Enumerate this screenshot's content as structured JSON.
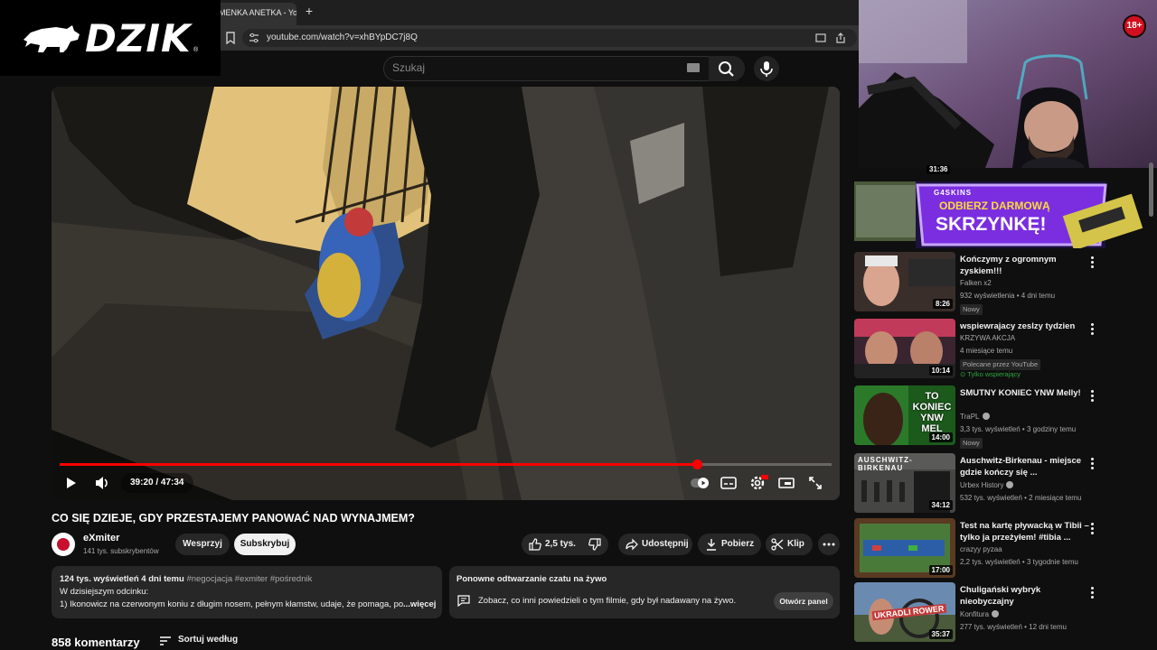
{
  "browser": {
    "tab_title": "MENKA ANETKA - You",
    "new_tab": "+",
    "url": "youtube.com/watch?v=xhBYpDC7j8Q"
  },
  "overlay_logo": {
    "text": "DZIK",
    "reg": "®"
  },
  "search": {
    "placeholder": "Szukaj"
  },
  "player": {
    "time": "39:20 / 47:34",
    "progress_fraction": 0.826
  },
  "video": {
    "title": "CO SIĘ DZIEJE, GDY PRZESTAJEMY PANOWAĆ NAD WYNAJMEM?",
    "channel": "eXmiter",
    "subscribers": "141 tys. subskrybentów",
    "join_label": "Wesprzyj",
    "subscribe_label": "Subskrybuj",
    "likes": "2,5 tys.",
    "share_label": "Udostępnij",
    "download_label": "Pobierz",
    "clip_label": "Klip"
  },
  "description": {
    "stats": "124 tys. wyświetleń  4 dni temu",
    "tags": "#negocjacja #exmiter #pośrednik",
    "line1": "W dzisiejszym odcinku:",
    "line2": "1) Ikonowicz na czerwonym koniu z długim nosem, pełnym kłamstw, udaje, że pomaga, poc",
    "more": "...więcej"
  },
  "chat_replay": {
    "title": "Ponowne odtwarzanie czatu na żywo",
    "text": "Zobacz, co inni powiedzieli o tym filmie, gdy był nadawany na żywo.",
    "button": "Otwórz panel"
  },
  "comments": {
    "count": "858 komentarzy",
    "sort_label": "Sortuj według"
  },
  "webcam": {
    "age_badge": "18+"
  },
  "sidebar": {
    "top_duration": "31:36",
    "ad": {
      "line1": "ODBIERZ DARMOWĄ",
      "line2": "SKRZYNKĘ!",
      "brand": "G4SKINS"
    },
    "items": [
      {
        "title": "Kończymy z ogromnym zyskiem!!!",
        "channel": "Falken x2",
        "meta": "932 wyświetlenia • 4 dni temu",
        "badge": "Nowy",
        "duration": "8:26"
      },
      {
        "title": "wspiewrajacy zeslzy tydzien",
        "channel": "KRZYWA AKCJA",
        "meta": "4 miesiące temu",
        "badge": "Polecane przez YouTube",
        "members": "Tylko wspierający",
        "duration": "10:14"
      },
      {
        "title": "SMUTNY KONIEC YNW Melly!",
        "channel": "TraPL",
        "meta": "3,3 tys. wyświetleń • 3 godziny temu",
        "badge": "Nowy",
        "duration": "14:00",
        "thumb_text": "TO KONIEC YNW MEL"
      },
      {
        "title": "Auschwitz-Birkenau - miejsce gdzie kończy się ...",
        "channel": "Urbex History",
        "meta": "532 tys. wyświetleń • 2 miesiące temu",
        "duration": "34:12",
        "thumb_text": "AUSCHWITZ-BIRKENAU"
      },
      {
        "title": "Test na kartę pływacką w Tibii – tylko ja przeżyłem!  #tibia ...",
        "channel": "crazyy pyzaa",
        "meta": "2,2 tys. wyświetleń • 3 tygodnie temu",
        "duration": "17:00"
      },
      {
        "title": "Chuligański wybryk nieobyczajny",
        "channel": "Konfitura",
        "meta": "277 tys. wyświetleń • 12 dni temu",
        "duration": "35:37",
        "thumb_text": "UKRADLI ROWER"
      }
    ]
  }
}
